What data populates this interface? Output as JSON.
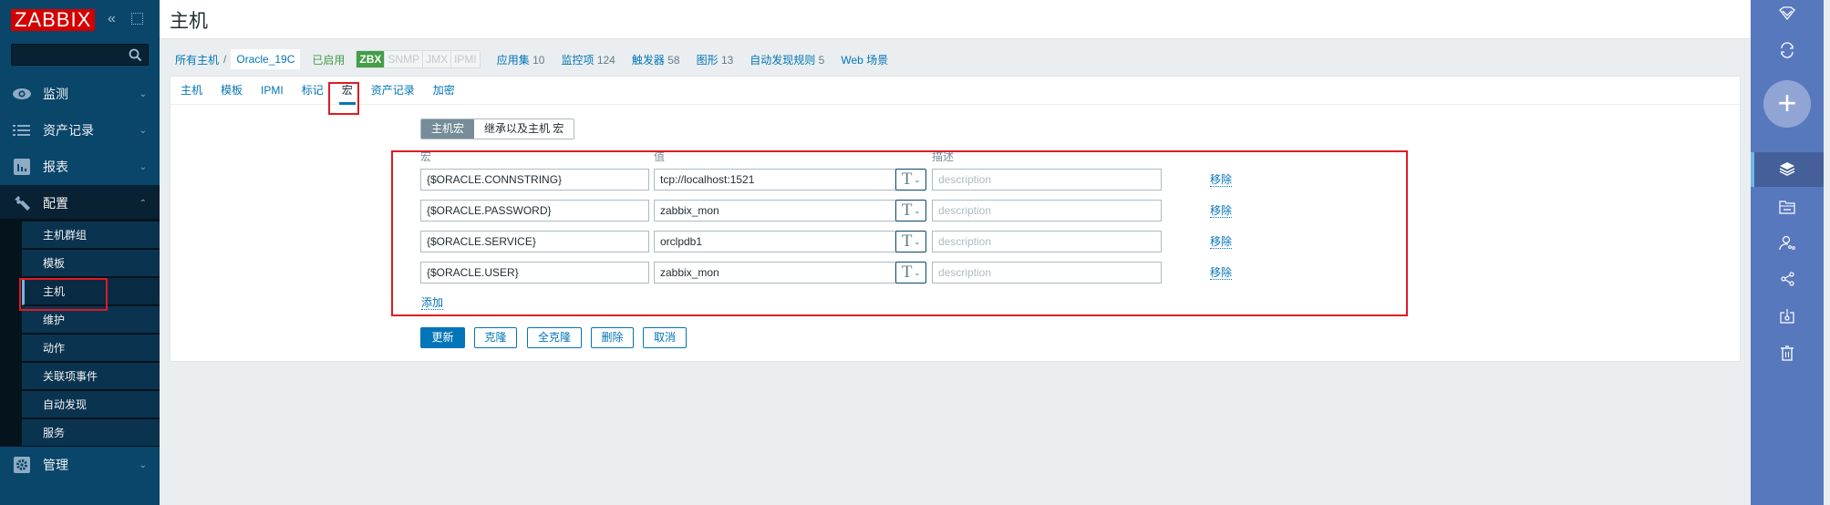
{
  "sidebar": {
    "logo": "ZABBIX",
    "collapse_icon": "«",
    "kiosk_icon": "⤡",
    "search_placeholder": "",
    "menu": [
      {
        "label": "监测",
        "icon": "eye-icon",
        "arrow": "⌄"
      },
      {
        "label": "资产记录",
        "icon": "list-icon",
        "arrow": "⌄"
      },
      {
        "label": "报表",
        "icon": "chart-icon",
        "arrow": "⌄"
      },
      {
        "label": "配置",
        "icon": "wrench-icon",
        "arrow": "⌃"
      },
      {
        "label": "管理",
        "icon": "gear-icon",
        "arrow": "⌄"
      }
    ],
    "config_submenu": [
      "主机群组",
      "模板",
      "主机",
      "维护",
      "动作",
      "关联项事件",
      "自动发现",
      "服务"
    ],
    "active_submenu": "主机"
  },
  "header": {
    "title": "主机"
  },
  "breadcrumb": {
    "all_hosts": "所有主机",
    "separator": "/",
    "host": "Oracle_19C",
    "status": "已启用",
    "availability": [
      "ZBX",
      "SNMP",
      "JMX",
      "IPMI"
    ],
    "counts": [
      {
        "label": "应用集",
        "value": "10"
      },
      {
        "label": "监控项",
        "value": "124"
      },
      {
        "label": "触发器",
        "value": "58"
      },
      {
        "label": "图形",
        "value": "13"
      },
      {
        "label": "自动发现规则",
        "value": "5"
      },
      {
        "label": "Web 场景",
        "value": ""
      }
    ]
  },
  "tabs": [
    {
      "label": "主机",
      "active": false
    },
    {
      "label": "模板",
      "active": false
    },
    {
      "label": "IPMI",
      "active": false
    },
    {
      "label": "标记",
      "active": false
    },
    {
      "label": "宏",
      "active": true
    },
    {
      "label": "资产记录",
      "active": false
    },
    {
      "label": "加密",
      "active": false
    }
  ],
  "macros": {
    "toggle": {
      "host_macros": "主机宏",
      "inherited": "继承以及主机 宏"
    },
    "headers": {
      "macro": "宏",
      "value": "值",
      "description": "描述"
    },
    "rows": [
      {
        "macro": "{$ORACLE.CONNSTRING}",
        "value": "tcp://localhost:1521",
        "type": "T",
        "description": "",
        "description_placeholder": "description",
        "remove": "移除"
      },
      {
        "macro": "{$ORACLE.PASSWORD}",
        "value": "zabbix_mon",
        "type": "T",
        "description": "",
        "description_placeholder": "description",
        "remove": "移除"
      },
      {
        "macro": "{$ORACLE.SERVICE}",
        "value": "orclpdb1",
        "type": "T",
        "description": "",
        "description_placeholder": "description",
        "remove": "移除"
      },
      {
        "macro": "{$ORACLE.USER}",
        "value": "zabbix_mon",
        "type": "T",
        "description": "",
        "description_placeholder": "description",
        "remove": "移除"
      }
    ],
    "add": "添加"
  },
  "actions": {
    "update": "更新",
    "clone": "克隆",
    "full_clone": "全克隆",
    "delete": "删除",
    "cancel": "取消"
  },
  "right_panel": {
    "icons": [
      "diamond-icon",
      "refresh-icon",
      "plus-icon",
      "layers-icon",
      "folder-icon",
      "user-settings-icon",
      "share-icon",
      "export-icon",
      "trash-icon"
    ]
  },
  "colors": {
    "brand": "#d40000",
    "accent": "#0275b8",
    "sidebar": "#0a466a",
    "right_panel": "#5878be",
    "highlight_box": "#e01a24",
    "status_ok": "#429e47"
  }
}
